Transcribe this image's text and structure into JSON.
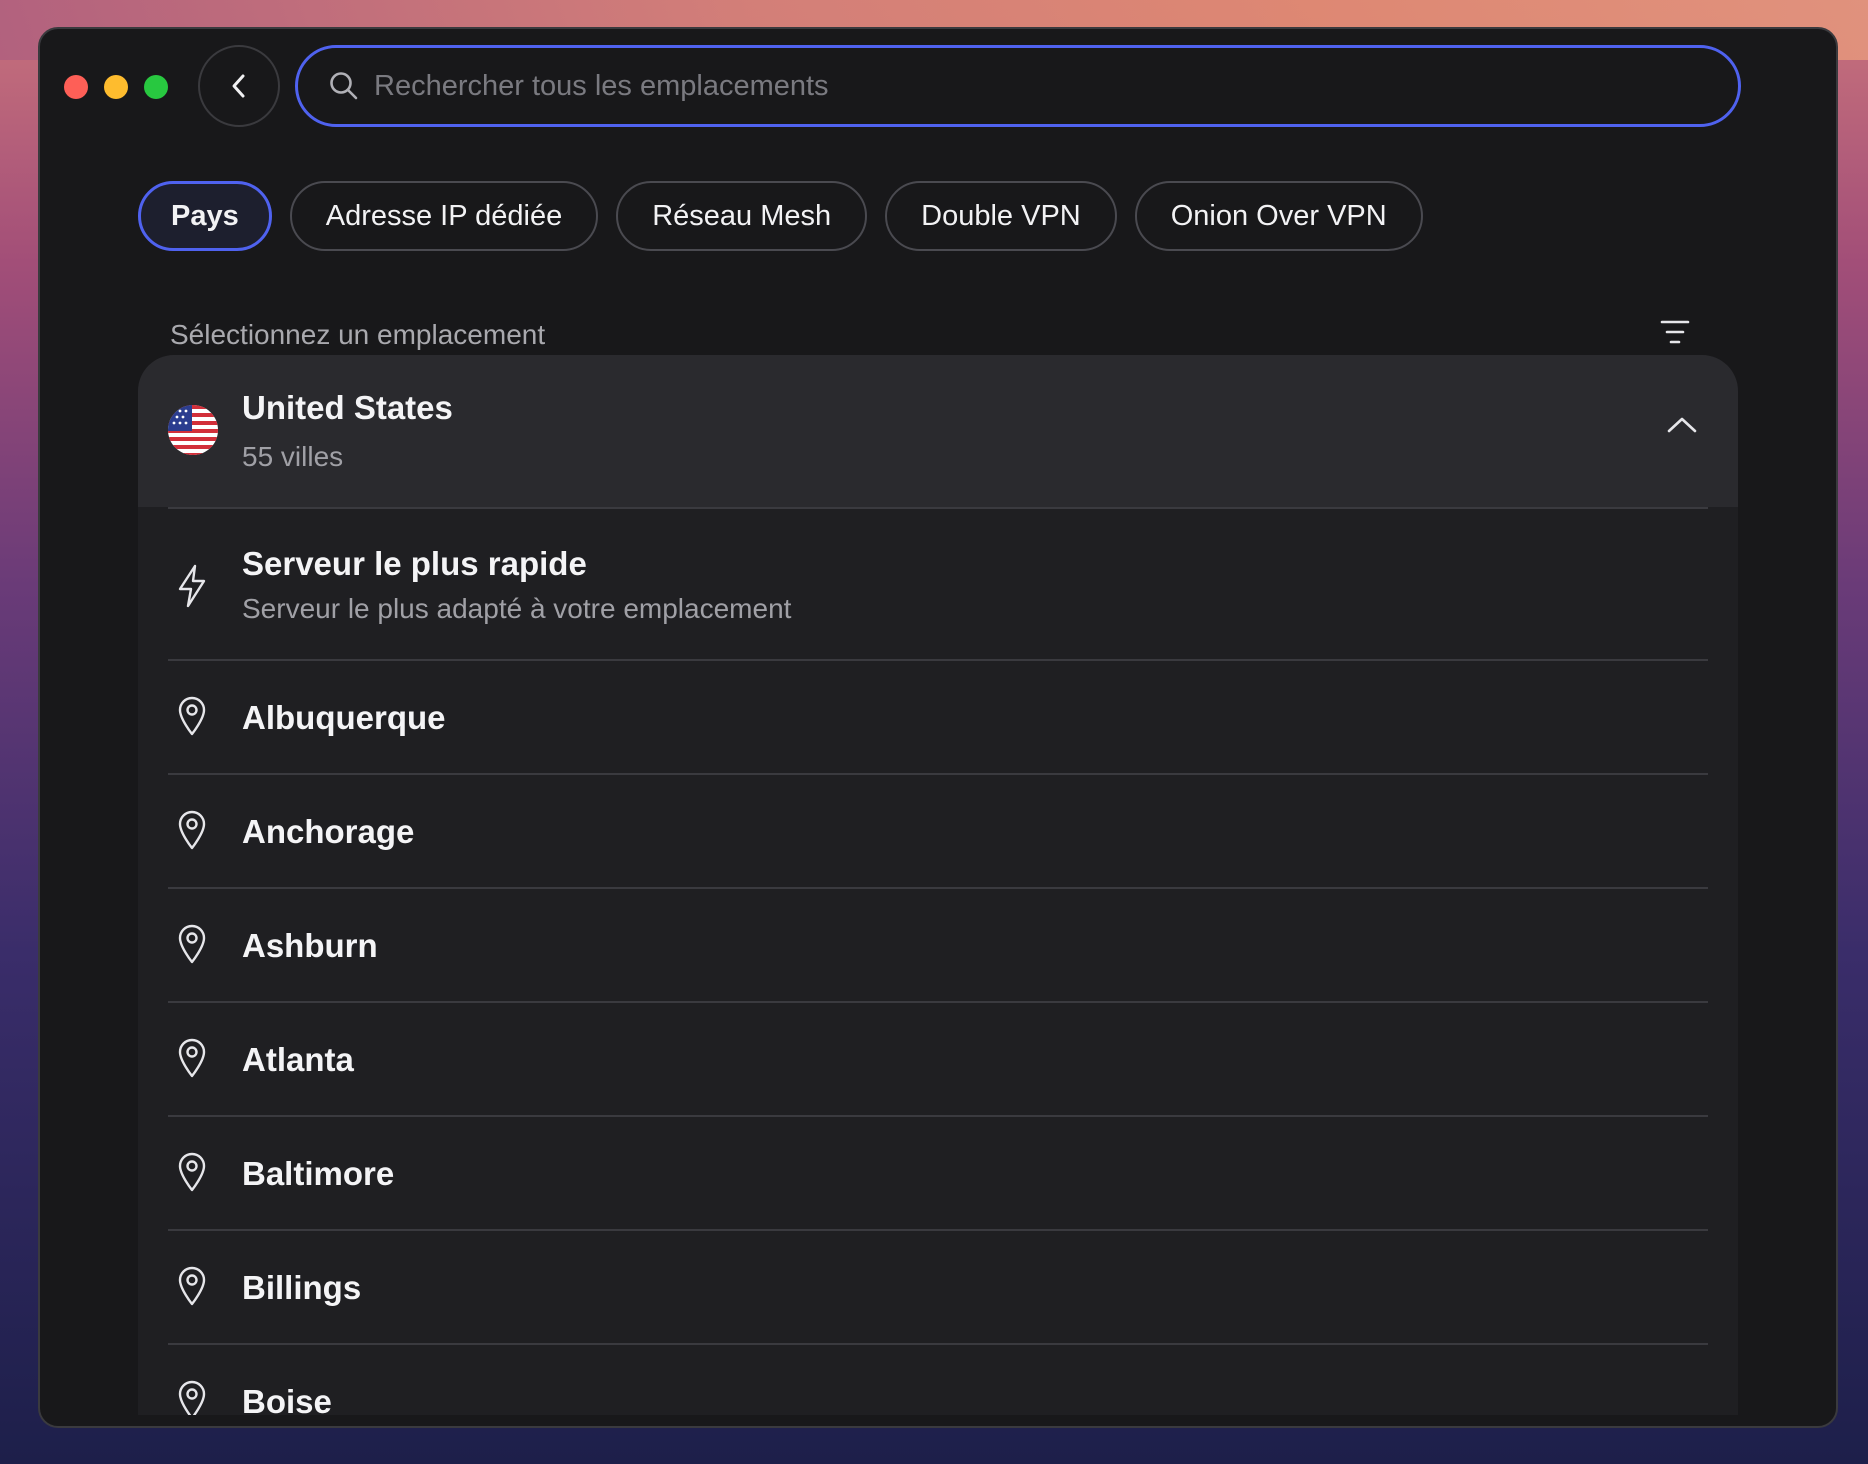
{
  "window": {
    "search": {
      "placeholder": "Rechercher tous les emplacements",
      "value": ""
    }
  },
  "tabs": [
    {
      "label": "Pays",
      "active": true
    },
    {
      "label": "Adresse IP dédiée",
      "active": false
    },
    {
      "label": "Réseau Mesh",
      "active": false
    },
    {
      "label": "Double VPN",
      "active": false
    },
    {
      "label": "Onion Over VPN",
      "active": false
    }
  ],
  "section": {
    "title": "Sélectionnez un emplacement"
  },
  "country": {
    "name": "United States",
    "subtitle": "55 villes",
    "flag_icon": "us-flag-icon",
    "expanded": true
  },
  "fastest": {
    "title": "Serveur le plus rapide",
    "subtitle": "Serveur le plus adapté à votre emplacement",
    "icon": "lightning-icon"
  },
  "cities": [
    "Albuquerque",
    "Anchorage",
    "Ashburn",
    "Atlanta",
    "Baltimore",
    "Billings",
    "Boise"
  ],
  "colors": {
    "accent": "#4f62ef",
    "window_bg": "#18181a",
    "panel_bg": "#1f1f22",
    "country_bg": "#2a2a2e"
  }
}
